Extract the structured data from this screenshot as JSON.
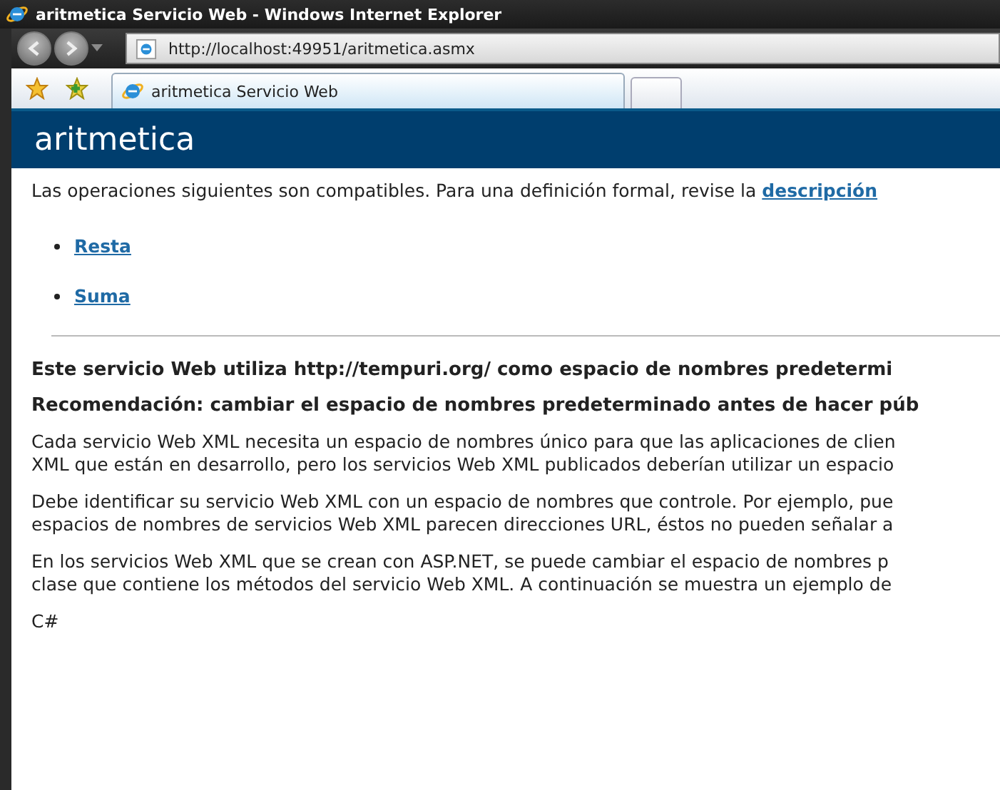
{
  "window": {
    "title": "aritmetica Servicio Web - Windows Internet Explorer"
  },
  "address_bar": {
    "value": "http://localhost:49951/aritmetica.asmx"
  },
  "tabs": [
    {
      "label": "aritmetica Servicio Web",
      "selected": true
    }
  ],
  "page": {
    "heading": "aritmetica",
    "intro": {
      "text": "Las operaciones siguientes son compatibles. Para una definición formal, revise la ",
      "link": "descripción"
    },
    "operations": [
      "Resta",
      "Suma"
    ],
    "notices": [
      "Este servicio Web utiliza http://tempuri.org/ como espacio de nombres predetermi",
      "Recomendación: cambiar el espacio de nombres predeterminado antes de hacer púb"
    ],
    "paragraphs": [
      [
        "Cada servicio Web XML necesita un espacio de nombres único para que las aplicaciones de clien",
        "XML que están en desarrollo, pero los servicios Web XML publicados deberían utilizar un espacio"
      ],
      [
        "Debe identificar su servicio Web XML con un espacio de nombres que controle. Por ejemplo, pue",
        "espacios de nombres de servicios Web XML parecen direcciones URL, éstos no pueden señalar a"
      ],
      [
        "En los servicios Web XML que se crean con ASP.NET, se puede cambiar el espacio de nombres p",
        "clase que contiene los métodos del servicio Web XML. A continuación se muestra un ejemplo de"
      ]
    ],
    "code_label": "C#"
  }
}
